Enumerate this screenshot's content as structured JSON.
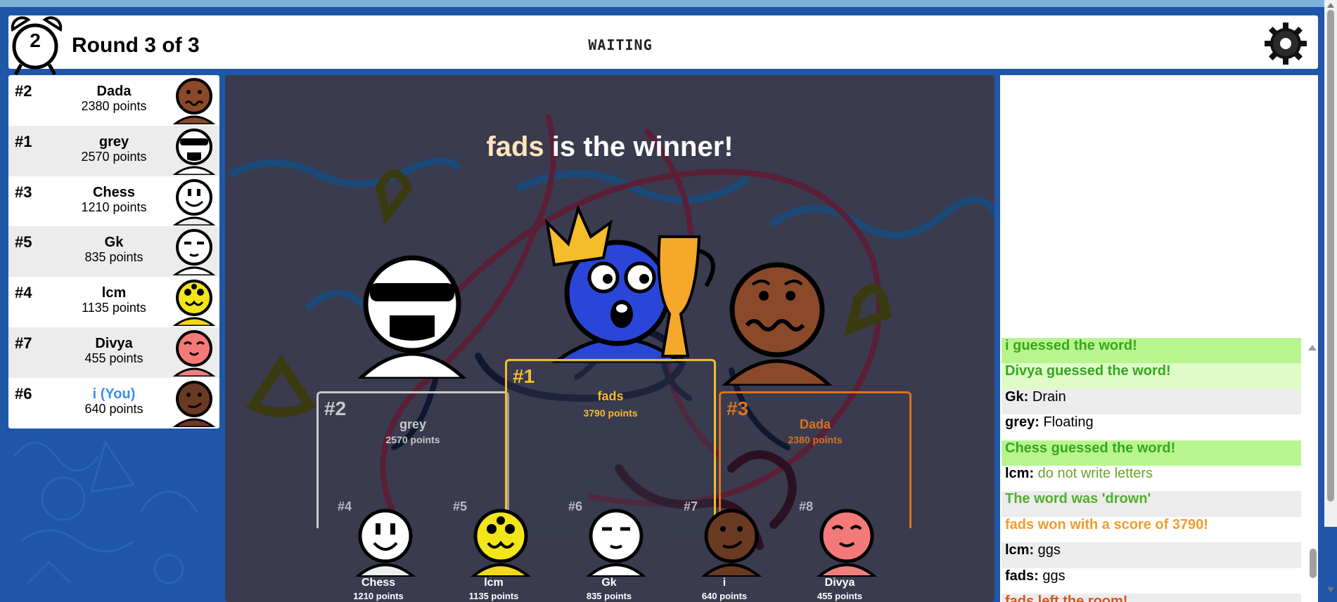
{
  "header": {
    "timer": "2",
    "round_label": "Round 3 of 3",
    "status": "WAITING",
    "icons": {
      "timer": "alarm-clock-icon",
      "settings": "gear-icon"
    }
  },
  "players": [
    {
      "rank": "#2",
      "name": "Dada",
      "points": "2380 points",
      "avatar": "brown-worried"
    },
    {
      "rank": "#1",
      "name": "grey",
      "points": "2570 points",
      "avatar": "white-sunglasses"
    },
    {
      "rank": "#3",
      "name": "Chess",
      "points": "1210 points",
      "avatar": "white-smile"
    },
    {
      "rank": "#5",
      "name": "Gk",
      "points": "835 points",
      "avatar": "white-smug"
    },
    {
      "rank": "#4",
      "name": "lcm",
      "points": "1135 points",
      "avatar": "yellow-happy"
    },
    {
      "rank": "#7",
      "name": "Divya",
      "points": "455 points",
      "avatar": "pink-smile"
    },
    {
      "rank": "#6",
      "name": "i (You)",
      "points": "640 points",
      "avatar": "brown-smirk"
    }
  ],
  "results": {
    "winner_name": "fads",
    "winner_suffix": " is the winner!",
    "podium": [
      {
        "rank": "#2",
        "name": "grey",
        "points": "2570 points",
        "color": "#c8c8c8"
      },
      {
        "rank": "#1",
        "name": "fads",
        "points": "3790 points",
        "color": "#f5bd2a"
      },
      {
        "rank": "#3",
        "name": "Dada",
        "points": "2380 points",
        "color": "#d9731e"
      }
    ],
    "others": [
      {
        "rank": "#4",
        "name": "Chess",
        "points": "1210 points",
        "avatar": "white-smile"
      },
      {
        "rank": "#5",
        "name": "lcm",
        "points": "1135 points",
        "avatar": "yellow-happy"
      },
      {
        "rank": "#6",
        "name": "Gk",
        "points": "835 points",
        "avatar": "white-smug"
      },
      {
        "rank": "#7",
        "name": "i",
        "points": "640 points",
        "avatar": "brown-smirk"
      },
      {
        "rank": "#8",
        "name": "Divya",
        "points": "455 points",
        "avatar": "pink-smile"
      }
    ]
  },
  "chat": [
    {
      "type": "guess-strong",
      "text": "i guessed the word!"
    },
    {
      "type": "guess-light",
      "text": "Divya guessed the word!"
    },
    {
      "type": "msg",
      "who": "Gk:",
      "text": " Drain"
    },
    {
      "type": "msg",
      "who": "grey:",
      "text": " Floating"
    },
    {
      "type": "guess-strong",
      "text": "Chess guessed the word!"
    },
    {
      "type": "msg-olive",
      "who": "lcm:",
      "text": " do not write letters"
    },
    {
      "type": "green",
      "text": "The word was 'drown'"
    },
    {
      "type": "orange",
      "text": "fads won with a score of 3790!"
    },
    {
      "type": "msg",
      "who": "lcm:",
      "text": " ggs"
    },
    {
      "type": "msg",
      "who": "fads:",
      "text": " ggs"
    },
    {
      "type": "red",
      "text": "fads left the room!"
    }
  ],
  "colors": {
    "background": "#1f56a8",
    "canvas": "#3a3b4f",
    "gold": "#f5bd2a",
    "bronze": "#d9731e",
    "silver": "#c8c8c8"
  }
}
